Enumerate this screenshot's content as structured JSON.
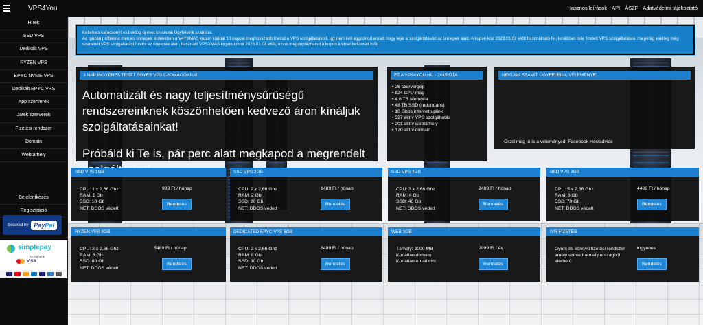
{
  "topbar": {
    "brand": "VPS4You",
    "links": [
      "Hasznos leírások",
      "API",
      "ÁSZF",
      "Adatvédelmi tájékoztató"
    ]
  },
  "sidebar": {
    "items": [
      "Hírek",
      "SSD VPS",
      "Dedikált VPS",
      "RYZEN VPS",
      "EPYC NVME VPS",
      "Dedikált EPYC VPS",
      "App szerverek",
      "Játék szerverek",
      "Fizetési rendszer",
      "Domain",
      "Webtárhely"
    ],
    "account": [
      "Bejelentkezés",
      "Regisztráció"
    ],
    "languages": [
      "hu-flag-icon",
      "uk-flag-icon"
    ],
    "paypal": {
      "prefix": "Secured by",
      "brand_a": "Pay",
      "brand_b": "Pal"
    },
    "simplepay": {
      "brand": "simplepay",
      "sub": "by otpbank",
      "visa": "VISA"
    }
  },
  "notice": {
    "lines": [
      "Kellemes karácsonyt és boldog új évet kívánunk Ügyfeleink számára.",
      "Az igazán probléma mentes ünnepek érdekében a V4YXMAS kupon kóddal 10 nappal meghosszabbíthatod a VPS szolgáltatásod, így nem kell aggódnod amiatt hogy lejár a szolgáltatásod az ünnepek alatt. A kupon kód 2023.01.02 előtt használható fel, korábban már fizetett VPS szolgáltatásra. Ha pedig esetleg még szeretnél VPS szolgáltatást fizetni az ünnepek alatt, használd VPSXMAS kupon kódot 2023.01.01 előtt, ezzel megduplázhatod a kupon kóddal befizetett időt!"
    ]
  },
  "hero": {
    "title": "3 NAP INGYENES TESZT EGYES VPS CSOMAGOKRA!",
    "line1": "Automatizált és nagy teljesítménysűrűségű rendszereinknek köszönhetően kedvező áron kínáljuk szolgáltatásainkat!",
    "line2": "Próbáld ki Te is, pár perc alatt megkapod a megrendelt szolgáltatást!"
  },
  "stats": {
    "title": "EZ A VPS4YOU.HU - 2015 ÓTA",
    "items": [
      "26 szervergép",
      "624 CPU mag",
      "4.6 TB Memória",
      "48 TB SSD (redundáns)",
      "10 Gbps internet uplink",
      "597 aktív VPS szolgáltatás",
      "201 aktív webtárhely",
      "170 aktív domain"
    ]
  },
  "reviews": {
    "title": "NEKÜNK SZÁMÍT ÜGYFELEINK VÉLEMÉNYE:",
    "footer": "Oszd meg te is a véleményed: Facebook Hostadvice"
  },
  "cards": [
    {
      "title": "SSD VPS 1GB",
      "specs": [
        "CPU: 1 x 2,66 Ghz",
        "RAM: 1 Gb",
        "SSD: 10 Gb",
        "NET: DDOS védett"
      ],
      "price": "989 Ft / hónap",
      "button": "Rendelés"
    },
    {
      "title": "SSD VPS 2GB",
      "specs": [
        "CPU: 2 x 2,66 Ghz",
        "RAM: 2 Gb",
        "SSD: 20 Gb",
        "NET: DDOS védett"
      ],
      "price": "1489 Ft / hónap",
      "button": "Rendelés"
    },
    {
      "title": "SSD VPS 4GB",
      "specs": [
        "CPU: 3 x 2,66 Ghz",
        "RAM: 4 Gb",
        "SSD: 40 Gb",
        "NET: DDOS védett"
      ],
      "price": "2489 Ft / hónap",
      "button": "Rendelés"
    },
    {
      "title": "SSD VPS 8GB",
      "specs": [
        "CPU: 5 x 2,66 Ghz",
        "RAM: 8 Gb",
        "SSD: 70 Gb",
        "NET: DDOS védett"
      ],
      "price": "4489 Ft / hónap",
      "button": "Rendelés"
    },
    {
      "title": "RYZEN VPS 8GB",
      "specs": [
        "CPU: 2 x 2,66 Ghz",
        "RAM: 8 Gb",
        "SSD: 80 Gb",
        "NET: DDOS védett"
      ],
      "price": "5489 Ft / hónap",
      "button": "Rendelés"
    },
    {
      "title": "DEDICATED EPYC VPS 8GB",
      "specs": [
        "CPU: 2 x 2,66 Ghz",
        "RAM: 8 Gb",
        "SSD: 80 Gb",
        "NET: DDOS védett"
      ],
      "price": "8499 Ft / hónap",
      "button": "Rendelés"
    },
    {
      "title": "WEB 3GB",
      "specs": [
        "Tárhely: 3000 MB",
        "Korlátlan domain",
        "Korlátlan email cím"
      ],
      "price": "2999 Ft / év",
      "button": "Rendelés"
    },
    {
      "title": "IVR FIZETÉS",
      "specs": [
        "Gyors és könnyű fizetési rendszer",
        "amely szinte bármely országból",
        "elérhető"
      ],
      "price": "ingyenes",
      "button": "Rendelés"
    }
  ],
  "colors": {
    "accent": "#1c7fd0",
    "notice_bg": "#1680c8",
    "panel_bg": "#0e0e0e",
    "sidebar_bg": "#0d0d0d"
  }
}
